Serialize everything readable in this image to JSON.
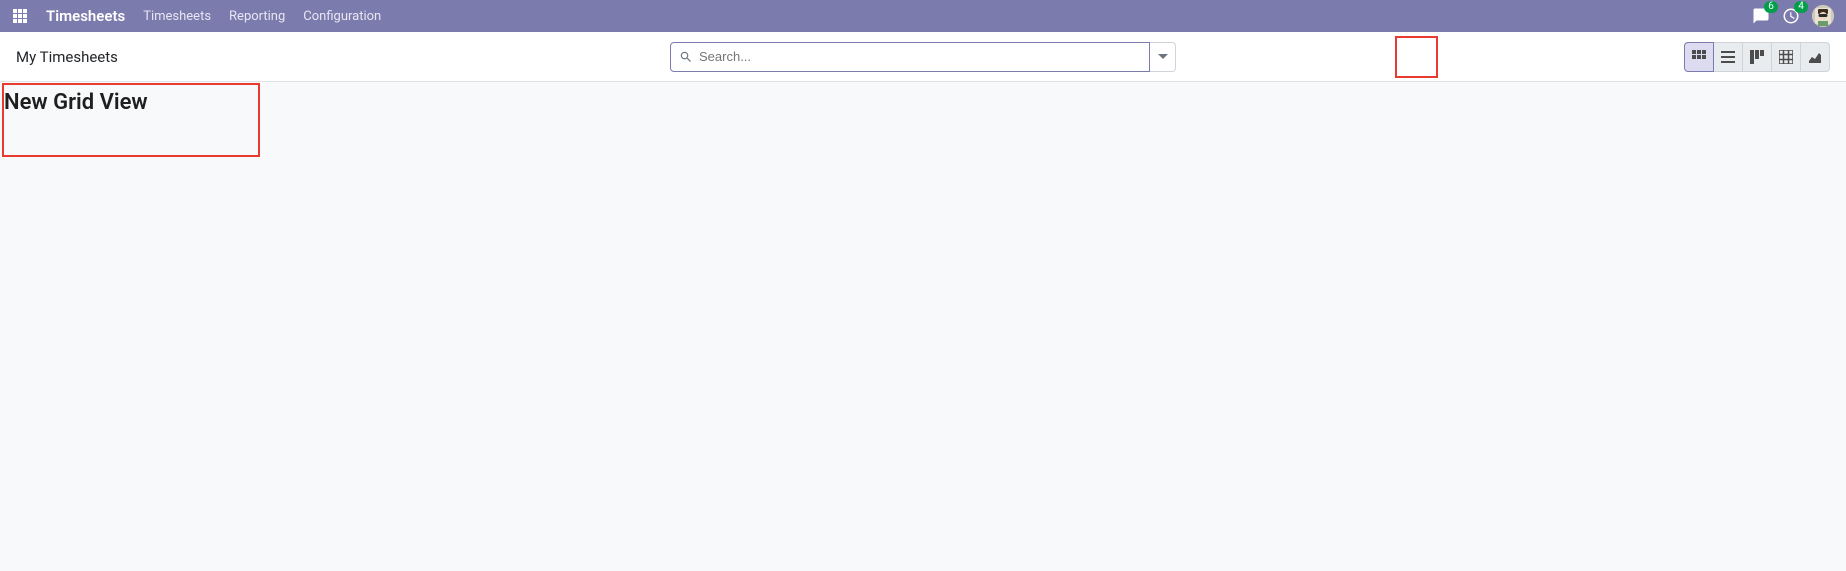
{
  "navbar": {
    "brand": "Timesheets",
    "items": [
      "Timesheets",
      "Reporting",
      "Configuration"
    ],
    "messages_badge": "6",
    "activities_badge": "4"
  },
  "controlbar": {
    "title": "My Timesheets",
    "search_placeholder": "Search..."
  },
  "views": {
    "grid": "grid-view",
    "list": "list-view",
    "kanban": "kanban-view",
    "pivot": "pivot-view",
    "graph": "graph-view"
  },
  "content": {
    "heading": "New Grid View"
  }
}
